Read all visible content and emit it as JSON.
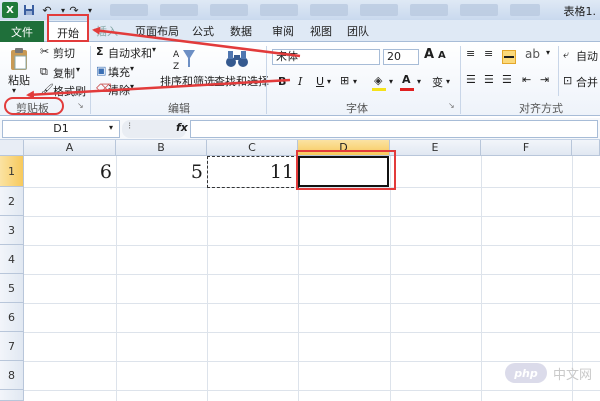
{
  "window": {
    "title": "表格1."
  },
  "tabs": {
    "file": "文件",
    "home": "开始",
    "insert": "插入",
    "page_layout": "页面布局",
    "formulas": "公式",
    "data": "数据",
    "review": "审阅",
    "view": "视图",
    "team": "团队"
  },
  "clipboard": {
    "paste": "粘贴",
    "cut": "剪切",
    "copy": "复制",
    "format_painter": "格式刷",
    "label": "剪贴板"
  },
  "editing": {
    "autosum": "自动求和",
    "fill": "填充",
    "clear": "清除",
    "sort_filter": "排序和筛选",
    "find_select": "查找和选择",
    "label": "编辑"
  },
  "font": {
    "name": "宋体",
    "size": "20",
    "bold": "B",
    "italic": "I",
    "underline": "U",
    "font_color": "A",
    "wen": "变",
    "label": "字体"
  },
  "alignment": {
    "merge": "合并",
    "auto": "自动",
    "label": "对齐方式"
  },
  "formula_bar": {
    "name_box": "D1",
    "fx": "fx",
    "content": ""
  },
  "sheet": {
    "columns": [
      "A",
      "B",
      "C",
      "D",
      "E",
      "F"
    ],
    "rows": [
      "1",
      "2",
      "3",
      "4",
      "5",
      "6",
      "7",
      "8"
    ],
    "cells": {
      "A1": "6",
      "B1": "5",
      "C1": "11"
    },
    "active_cell": "D1"
  },
  "watermark": {
    "logo": "php",
    "text": "中文网"
  }
}
